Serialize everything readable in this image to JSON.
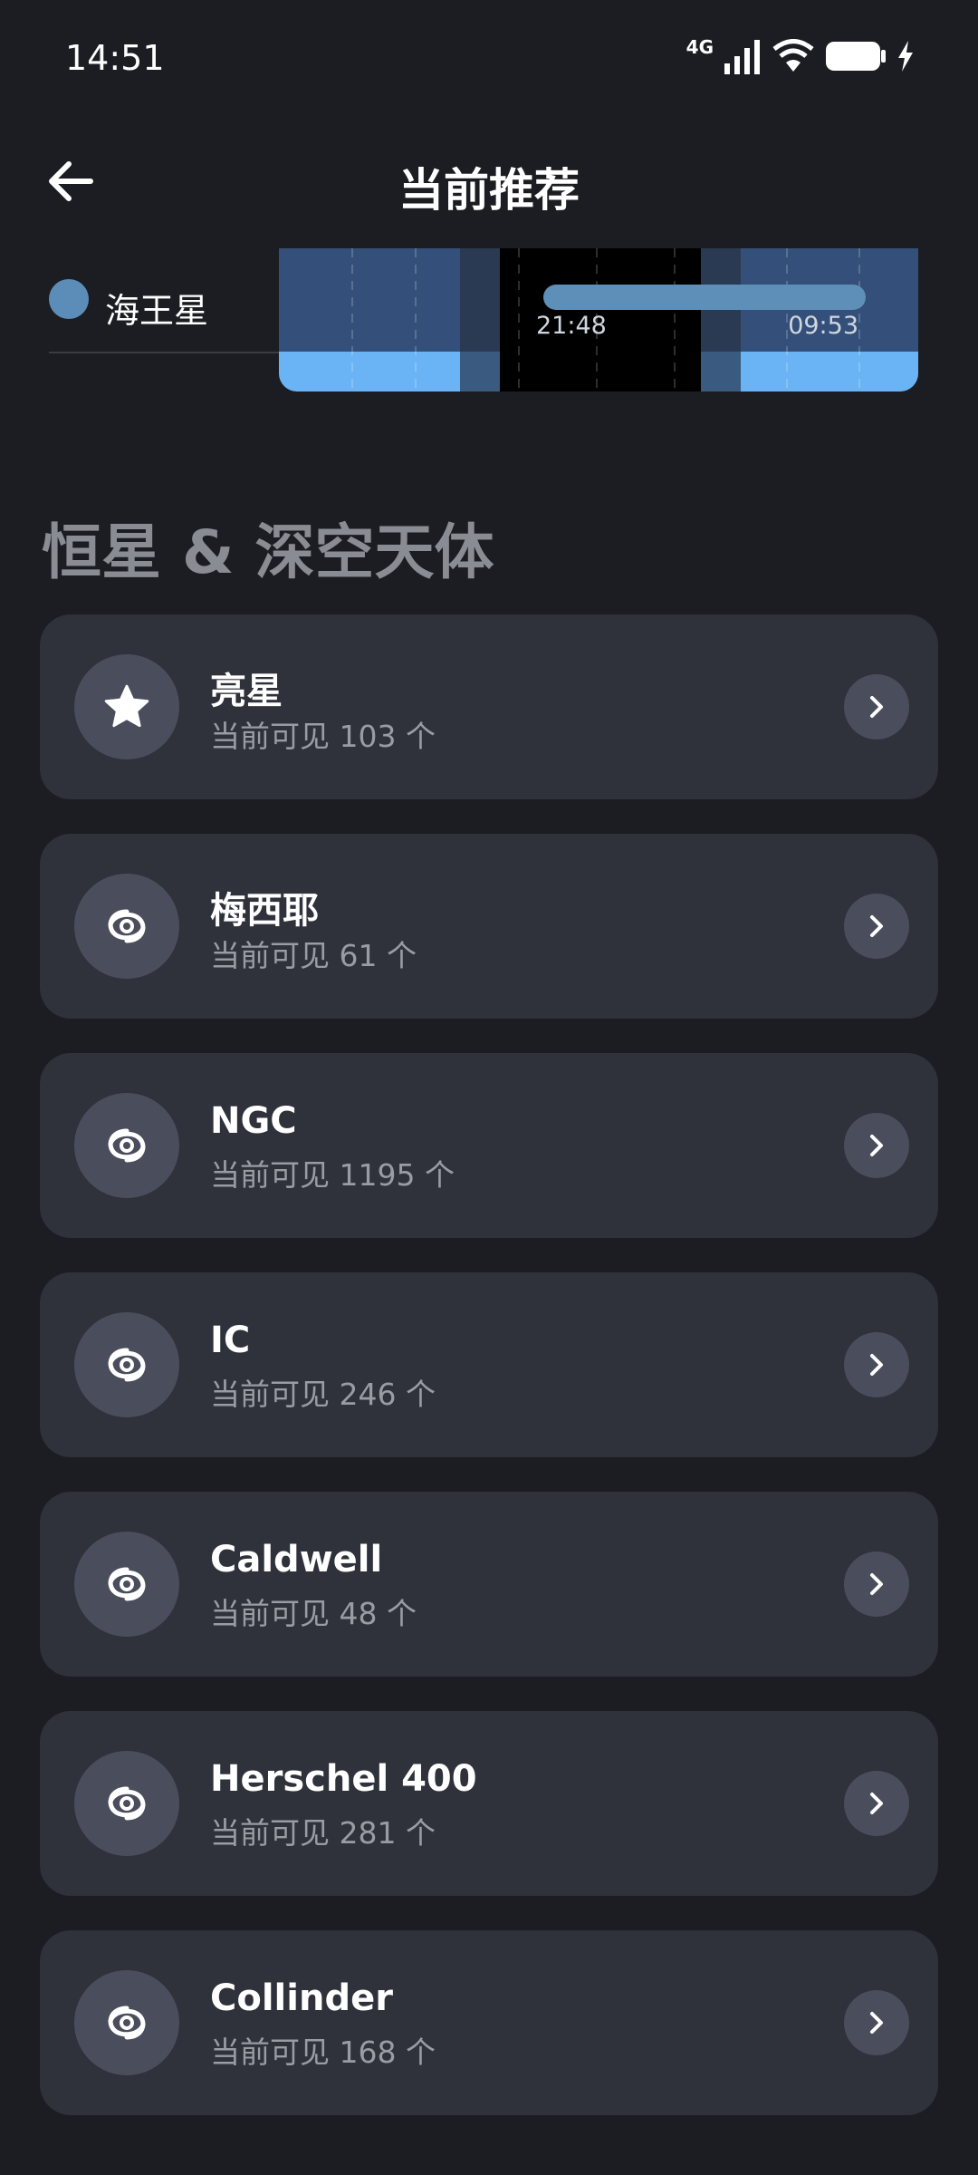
{
  "status": {
    "time": "14:51",
    "network": "4G",
    "icons": [
      "signal-icon",
      "wifi-icon",
      "battery-icon",
      "charging-icon"
    ]
  },
  "header": {
    "title": "当前推荐",
    "back_icon": "arrow-left-icon"
  },
  "planet": {
    "name": "海王星",
    "color": "#5b8db8",
    "visible_start": "21:48",
    "visible_end": "09:53"
  },
  "section": {
    "title": "恒星 & 深空天体"
  },
  "catalogs": [
    {
      "title": "亮星",
      "subtitle": "当前可见 103 个",
      "icon": "star-icon"
    },
    {
      "title": "梅西耶",
      "subtitle": "当前可见 61 个",
      "icon": "galaxy-icon"
    },
    {
      "title": "NGC",
      "subtitle": "当前可见 1195 个",
      "icon": "galaxy-icon"
    },
    {
      "title": "IC",
      "subtitle": "当前可见 246 个",
      "icon": "galaxy-icon"
    },
    {
      "title": "Caldwell",
      "subtitle": "当前可见 48 个",
      "icon": "galaxy-icon"
    },
    {
      "title": "Herschel 400",
      "subtitle": "当前可见 281 个",
      "icon": "galaxy-icon"
    },
    {
      "title": "Collinder",
      "subtitle": "当前可见 168 个",
      "icon": "galaxy-icon"
    }
  ],
  "colors": {
    "background": "#1c1d22",
    "card": "#2f313b",
    "icon_circle": "#4a4e5c",
    "accent": "#5e8fb8",
    "daylight": "#6ab4f5"
  }
}
